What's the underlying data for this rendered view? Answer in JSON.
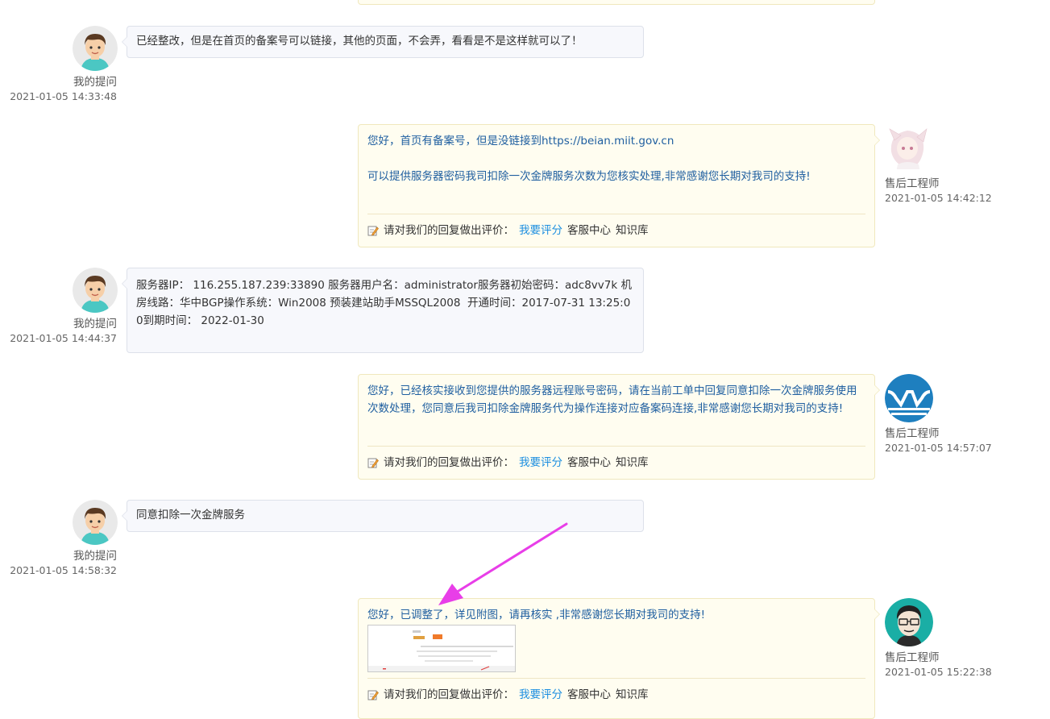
{
  "messages": [
    {
      "role": "user",
      "author": "我的提问",
      "time": "2021-01-05 14:33:48",
      "text": "已经整改，但是在首页的备案号可以链接，其他的页面，不会弄，看看是不是这样就可以了！"
    },
    {
      "role": "staff",
      "author": "售后工程师",
      "time": "2021-01-05 14:42:12",
      "text": "您好，首页有备案号，但是没链接到https://beian.miit.gov.cn\n\n可以提供服务器密码我司扣除一次金牌服务次数为您核实处理,非常感谢您长期对我司的支持!"
    },
    {
      "role": "user",
      "author": "我的提问",
      "time": "2021-01-05 14:44:37",
      "text": "服务器IP： 116.255.187.239:33890 服务器用户名：administrator服务器初始密码：adc8vv7k 机房线路：华中BGP操作系统：Win2008 预装建站助手MSSQL2008  开通时间：2017-07-31 13:25:00到期时间： 2022-01-30"
    },
    {
      "role": "staff",
      "author": "售后工程师",
      "time": "2021-01-05 14:57:07",
      "text": "您好，已经核实接收到您提供的服务器远程账号密码，请在当前工单中回复同意扣除一次金牌服务使用次数处理，您同意后我司扣除金牌服务代为操作连接对应备案码连接,非常感谢您长期对我司的支持!"
    },
    {
      "role": "user",
      "author": "我的提问",
      "time": "2021-01-05 14:58:32",
      "text": "同意扣除一次金牌服务"
    },
    {
      "role": "staff",
      "author": "售后工程师",
      "time": "2021-01-05 15:22:38",
      "text": "您好，已调整了，详见附图，请再核实 ,非常感谢您长期对我司的支持!"
    }
  ],
  "rating_bar": {
    "prompt": "请对我们的回复做出评价：",
    "rate_link": "我要评分",
    "service_link": "客服中心",
    "kb_link": "知识库"
  },
  "colors": {
    "staff_text": "#1f5fa0",
    "link": "#1d8fe0",
    "arrow": "#e83ee8"
  }
}
